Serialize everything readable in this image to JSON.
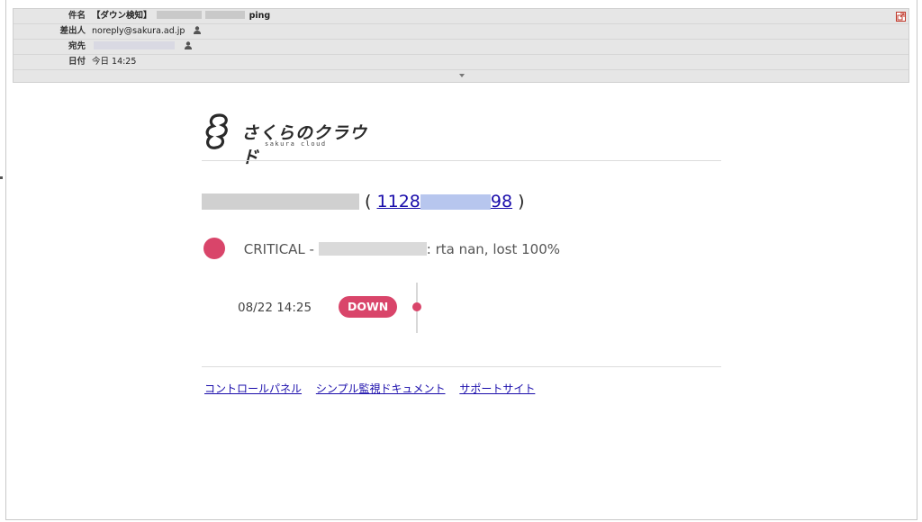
{
  "header": {
    "subject_label": "件名",
    "subject_prefix": "【ダウン検知】",
    "subject_suffix": "ping",
    "from_label": "差出人",
    "from_value": "noreply@sakura.ad.jp",
    "to_label": "宛先",
    "date_label": "日付",
    "date_value": "今日 14:25"
  },
  "brand": {
    "name": "さくらのクラウド",
    "sub": "sakura cloud"
  },
  "server": {
    "open_paren": "(",
    "id_prefix": "1128",
    "id_suffix": "98",
    "close_paren": ")"
  },
  "alert": {
    "level": "CRITICAL -",
    "message": ": rta nan, lost 100%",
    "color": "#d9456a"
  },
  "event": {
    "time": "08/22 14:25",
    "badge": "DOWN"
  },
  "footer_links": [
    "コントロールパネル",
    "シンプル監視ドキュメント",
    "サポートサイト"
  ]
}
